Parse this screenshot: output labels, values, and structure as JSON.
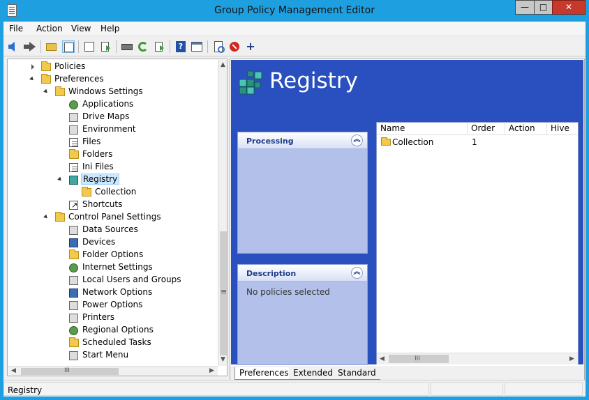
{
  "window": {
    "title": "Group Policy Management Editor",
    "min_label": "—",
    "max_label": "□",
    "close_label": "✕"
  },
  "menu": {
    "items": [
      "File",
      "Action",
      "View",
      "Help"
    ]
  },
  "toolbar": {
    "buttons": [
      "back-icon",
      "forward-icon",
      "up-folder-icon",
      "show-hide-tree-icon",
      "copy-icon",
      "paste-icon",
      "print-icon",
      "refresh-icon",
      "export-icon",
      "help-icon",
      "properties-icon",
      "new-item-icon",
      "stop-icon",
      "add-icon"
    ]
  },
  "tree": {
    "items": [
      {
        "label": "Policies",
        "level": 1,
        "expander": "closed",
        "icon": "folder-icon"
      },
      {
        "label": "Preferences",
        "level": 1,
        "expander": "open",
        "icon": "folder-icon"
      },
      {
        "label": "Windows Settings",
        "level": 2,
        "expander": "open",
        "icon": "folder-icon"
      },
      {
        "label": "Applications",
        "level": 3,
        "expander": "",
        "icon": "applications-icon"
      },
      {
        "label": "Drive Maps",
        "level": 3,
        "expander": "",
        "icon": "drive-maps-icon"
      },
      {
        "label": "Environment",
        "level": 3,
        "expander": "",
        "icon": "environment-icon"
      },
      {
        "label": "Files",
        "level": 3,
        "expander": "",
        "icon": "files-icon"
      },
      {
        "label": "Folders",
        "level": 3,
        "expander": "",
        "icon": "folders-icon"
      },
      {
        "label": "Ini Files",
        "level": 3,
        "expander": "",
        "icon": "ini-files-icon"
      },
      {
        "label": "Registry",
        "level": 3,
        "expander": "open",
        "icon": "registry-icon",
        "selected": true
      },
      {
        "label": "Collection",
        "level": 4,
        "expander": "",
        "icon": "folder-icon"
      },
      {
        "label": "Shortcuts",
        "level": 3,
        "expander": "",
        "icon": "shortcuts-icon"
      },
      {
        "label": "Control Panel Settings",
        "level": 2,
        "expander": "open",
        "icon": "control-panel-icon"
      },
      {
        "label": "Data Sources",
        "level": 3,
        "expander": "",
        "icon": "data-sources-icon"
      },
      {
        "label": "Devices",
        "level": 3,
        "expander": "",
        "icon": "devices-icon"
      },
      {
        "label": "Folder Options",
        "level": 3,
        "expander": "",
        "icon": "folder-options-icon"
      },
      {
        "label": "Internet Settings",
        "level": 3,
        "expander": "",
        "icon": "internet-settings-icon"
      },
      {
        "label": "Local Users and Groups",
        "level": 3,
        "expander": "",
        "icon": "local-users-icon"
      },
      {
        "label": "Network Options",
        "level": 3,
        "expander": "",
        "icon": "network-options-icon"
      },
      {
        "label": "Power Options",
        "level": 3,
        "expander": "",
        "icon": "power-options-icon"
      },
      {
        "label": "Printers",
        "level": 3,
        "expander": "",
        "icon": "printers-icon"
      },
      {
        "label": "Regional Options",
        "level": 3,
        "expander": "",
        "icon": "regional-options-icon"
      },
      {
        "label": "Scheduled Tasks",
        "level": 3,
        "expander": "",
        "icon": "scheduled-tasks-icon"
      },
      {
        "label": "Start Menu",
        "level": 3,
        "expander": "",
        "icon": "start-menu-icon"
      }
    ],
    "hscroll_grip": "III",
    "vscroll_grip": "≡"
  },
  "detail": {
    "heading": "Registry",
    "processing_title": "Processing",
    "description_title": "Description",
    "description_text": "No policies selected",
    "collapse_symbol": "︽",
    "list": {
      "columns": [
        "Name",
        "Order",
        "Action",
        "Hive"
      ],
      "rows": [
        {
          "name": "Collection",
          "order": "1",
          "action": "",
          "hive": ""
        }
      ],
      "hscroll_grip": "III"
    },
    "tabs": [
      "Preferences",
      "Extended",
      "Standard"
    ],
    "active_tab": "Preferences"
  },
  "status": {
    "text": "Registry"
  },
  "colors": {
    "title_bar": "#1ea0e0",
    "detail_background": "#2a4fbe",
    "panel": "#b3c1ea",
    "selection": "#cce8ff",
    "close_button": "#c7392b"
  }
}
